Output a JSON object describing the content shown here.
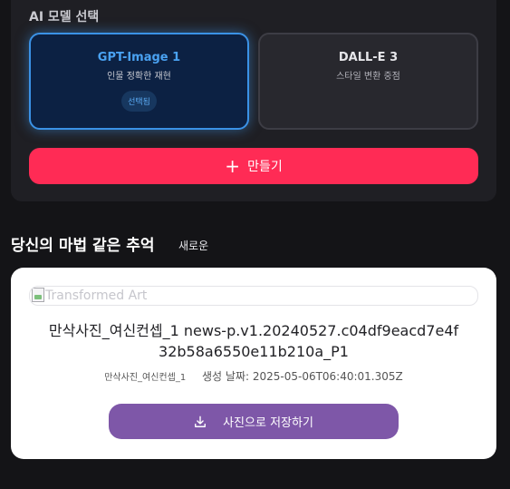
{
  "model_section": {
    "label": "AI 모델 선택",
    "models": [
      {
        "name": "GPT-Image 1",
        "desc": "인물 정확한 재현",
        "badge": "선택됨"
      },
      {
        "name": "DALL-E 3",
        "desc": "스타일 변환 중점"
      }
    ]
  },
  "create_button": {
    "icon": "plus-icon",
    "label": "만들기"
  },
  "gallery": {
    "title": "당신의 마법 같은 추억",
    "tag": "새로운",
    "card": {
      "image_alt": "Transformed Art",
      "file_name": "만삭사진_여신컨셉_1 news-p.v1.20240527.c04df9eacd7e4f32b58a6550e11b210a_P1",
      "category": "만삭사진_여신컨셉_1",
      "created_label": "생성 날짜: 2025-05-06T06:40:01.305Z",
      "save_label": "사진으로 저장하기",
      "save_icon": "download-icon"
    }
  },
  "colors": {
    "accent_create": "#ff2b55",
    "accent_selected": "#3b92e6",
    "save_button": "#7e57a8"
  }
}
